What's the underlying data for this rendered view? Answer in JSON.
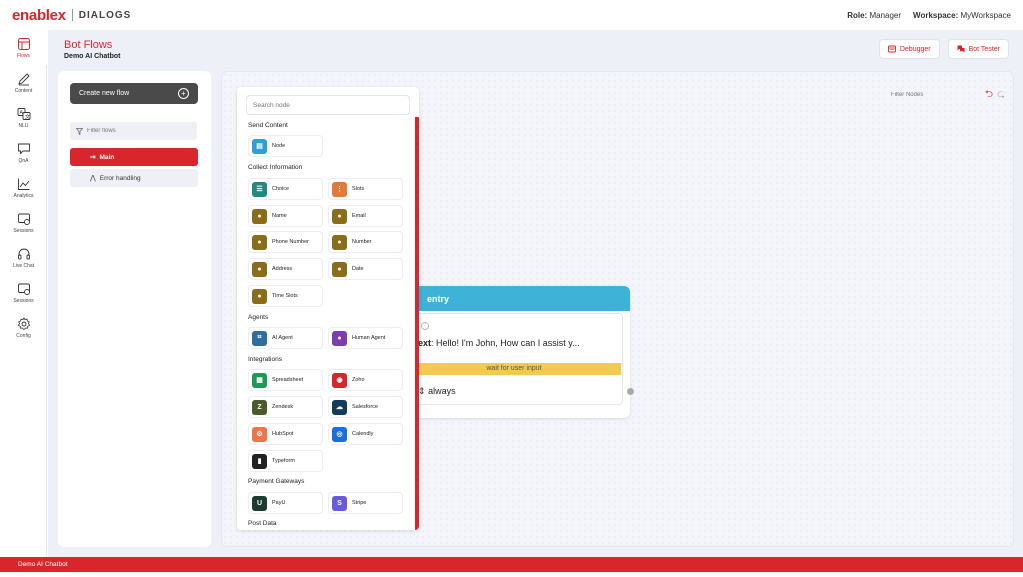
{
  "brand": {
    "name": "enablex",
    "product": "DIALOGS",
    "color": "#d9262c"
  },
  "topbar": {
    "role_label": "Role:",
    "role_value": "Manager",
    "workspace_label": "Workspace:",
    "workspace_value": "MyWorkspace"
  },
  "nav": [
    {
      "label": "Flows",
      "icon": "flows-icon",
      "active": true
    },
    {
      "label": "Content",
      "icon": "pencil-icon"
    },
    {
      "label": "NLU",
      "icon": "translate-icon"
    },
    {
      "label": "QnA",
      "icon": "chat-icon"
    },
    {
      "label": "Analytics",
      "icon": "chart-icon"
    },
    {
      "label": "Sessions",
      "icon": "sessions-icon"
    },
    {
      "label": "Live Chat",
      "icon": "headset-icon"
    },
    {
      "label": "Sessions",
      "icon": "sessions-icon"
    },
    {
      "label": "Config",
      "icon": "gear-icon"
    }
  ],
  "header": {
    "title": "Bot Flows",
    "subtitle": "Demo AI Chatbot",
    "debugger": "Debugger",
    "bot_tester": "Bot Tester"
  },
  "flows": {
    "create_label": "Create new flow",
    "filter_placeholder": "Filter flows",
    "items": [
      {
        "label": "Main",
        "active": true
      },
      {
        "label": "Error handling"
      }
    ]
  },
  "canvas": {
    "filter_placeholder": "Filter Nodes"
  },
  "palette": {
    "search_placeholder": "Search node",
    "sections": {
      "send_content": "Send Content",
      "collect": "Collect Information",
      "agents": "Agents",
      "integrations": "Integrations",
      "payment": "Payment Gateways",
      "post_data": "Post Data"
    },
    "nodes": {
      "node": "Node",
      "choice": "Choice",
      "slots": "Slots",
      "name": "Name",
      "email": "Email",
      "phone": "Phone Number",
      "number": "Number",
      "address": "Address",
      "date": "Date",
      "time_slots": "Time Slots",
      "ai_agent": "AI Agent",
      "human_agent": "Human Agent",
      "spreadsheet": "Spreadsheet",
      "zoho": "Zoho",
      "zendesk": "Zendesk",
      "salesforce": "Salesforce",
      "hubspot": "HubSpot",
      "calendly": "Calendly",
      "typeform": "Typeform",
      "payu": "PayU",
      "stripe": "Stripe"
    }
  },
  "entry": {
    "title": "entry",
    "text_label": "ext",
    "text_value": ": Hello! I'm John, How can I assist y...",
    "wait": "wait for user input",
    "transition": "always"
  },
  "footer": {
    "label": "Demo AI Chatbot"
  }
}
